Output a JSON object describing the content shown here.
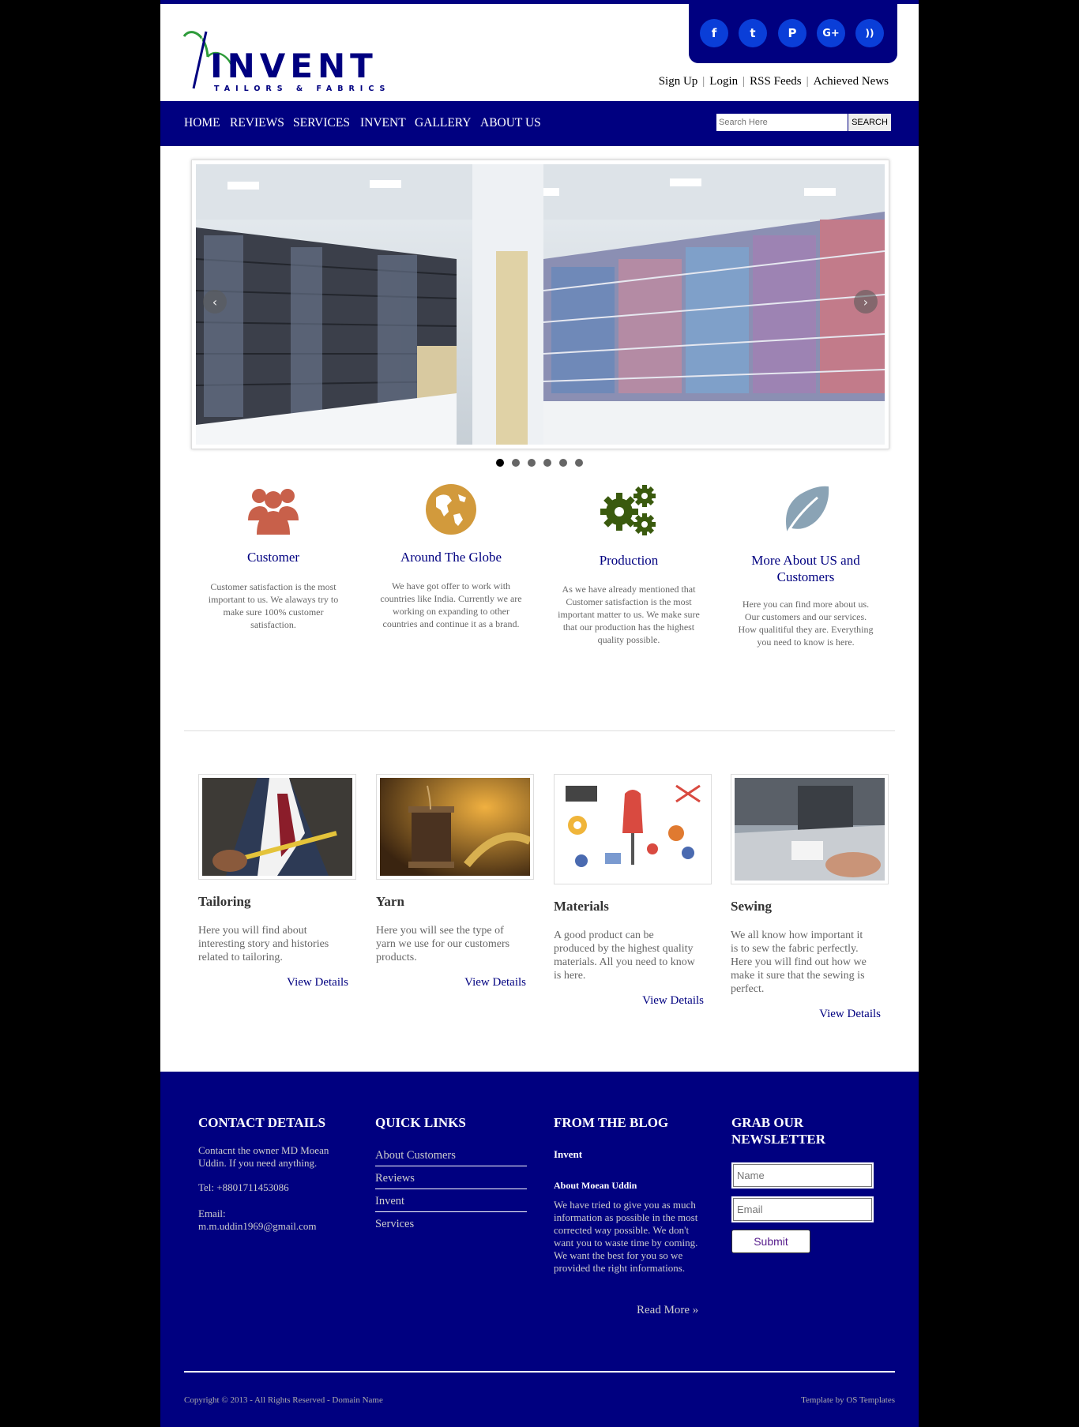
{
  "colors": {
    "brand": "#000080",
    "social": "#0a3ed8",
    "feature_customer": "#c8604a",
    "feature_globe": "#d29a3c",
    "feature_production": "#3a5a0e",
    "feature_more": "#8aa3b5"
  },
  "header": {
    "logo": {
      "name": "INVENT",
      "tagline": "TAILORS & FABRICS"
    },
    "social": [
      {
        "icon": "facebook-icon",
        "glyph": "f"
      },
      {
        "icon": "twitter-icon",
        "glyph": "t"
      },
      {
        "icon": "pinterest-icon",
        "glyph": "P"
      },
      {
        "icon": "google-plus-icon",
        "glyph": "G+"
      },
      {
        "icon": "rss-icon",
        "glyph": "))"
      }
    ],
    "links": [
      "Sign Up",
      "Login",
      "RSS Feeds",
      "Achieved News"
    ]
  },
  "nav": {
    "items": [
      "HOME",
      "REVIEWS",
      "SERVICES",
      "INVENT",
      "GALLERY",
      "ABOUT US"
    ],
    "search_placeholder": "Search Here",
    "search_button": "SEARCH"
  },
  "slider": {
    "prev": "‹",
    "next": "›",
    "active_dot": 0,
    "dot_count": 6
  },
  "features": [
    {
      "title": "Customer",
      "text": "Customer satisfaction is the most important to us. We alaways try to make sure 100% customer satisfaction."
    },
    {
      "title": "Around The Globe",
      "text": "We have got offer to work with countries like India. Currently we are working on expanding to other countries and continue it as a brand."
    },
    {
      "title": "Production",
      "text": "As we have already mentioned that Customer satisfaction is the most important matter to us. We make sure that our production has the highest quality possible."
    },
    {
      "title": "More About US and Customers",
      "text": "Here you can find more about us. Our customers and our services. How qualitiful they are. Everything you need to know is here."
    }
  ],
  "cards": [
    {
      "title": "Tailoring",
      "text": "Here you will find about interesting story and histories related to tailoring.",
      "link": "View Details"
    },
    {
      "title": "Yarn",
      "text": "Here you will see the type of yarn we use for our customers products.",
      "link": "View Details"
    },
    {
      "title": "Materials",
      "text": "A good product can be produced by the highest quality materials. All you need to know is here.",
      "link": "View Details"
    },
    {
      "title": "Sewing",
      "text": "We all know how important it is to sew the fabric perfectly. Here you will find out how we make it sure that the sewing is perfect.",
      "link": "View Details"
    }
  ],
  "footer": {
    "contact": {
      "heading": "CONTACT DETAILS",
      "text": "Contacnt the owner MD Moean Uddin. If you need anything.",
      "tel": "Tel: +8801711453086",
      "email_label": "Email:",
      "email": "m.m.uddin1969@gmail.com"
    },
    "quick_links": {
      "heading": "QUICK LINKS",
      "items": [
        "About Customers",
        "Reviews",
        "Invent",
        "Services"
      ]
    },
    "blog": {
      "heading": "FROM THE BLOG",
      "post_title": "Invent",
      "post_subtitle": "About Moean Uddin",
      "post_text": "We have tried to give you as much information as possible in the most corrected way possible. We don't want you to waste time by coming. We want the best for you so we provided the right informations.",
      "read_more": "Read More »"
    },
    "newsletter": {
      "heading": "GRAB OUR NEWSLETTER",
      "name_placeholder": "Name",
      "email_placeholder": "Email",
      "submit": "Submit"
    },
    "copyright": "Copyright © 2013 - All Rights Reserved - Domain Name",
    "credit": "Template by OS Templates"
  }
}
